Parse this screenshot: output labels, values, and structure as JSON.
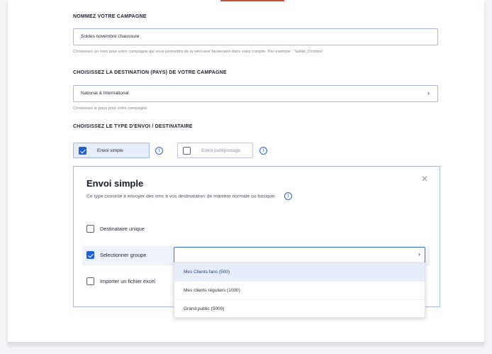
{
  "campaign_name": {
    "title": "NOMMEZ VOTRE CAMPAGNE",
    "value": "Soldes novembre chaussure",
    "hint": "Choisissez un nom pour votre campagne qui vous permettra de la retrouver facilement dans votre compte. Par exemple : 'Solde_Octobre'"
  },
  "destination": {
    "title": "CHOISISSEZ LA DESTINATION (PAYS) DE VOTRE CAMPAGNE",
    "value": "National & International",
    "hint": "Choisissez le pays pour votre campagne"
  },
  "send_type": {
    "title": "CHOISISSEZ LE TYPE D'ENVOI / DESTINATAIRE",
    "options": [
      {
        "label": "Envoi simple",
        "checked": true
      },
      {
        "label": "Envoi publipostage",
        "checked": false
      }
    ]
  },
  "panel": {
    "title": "Envoi simple",
    "description": "Ce type consiste à envoyer des sms à vos destinataires de manière normale ou basique.",
    "recipients": [
      {
        "label": "Destinataire unique",
        "checked": false
      },
      {
        "label": "Selectionner groupe",
        "checked": true
      },
      {
        "label": "Importer un fichier excel",
        "checked": false
      }
    ]
  },
  "group_select": {
    "value": "",
    "options": [
      "Mes Clients fans (500)",
      "Mes clients réguliers (1000)",
      "Grand public (5000)"
    ],
    "highlighted": "Mes Clients fans (500)"
  },
  "icons": {
    "chevron": "chevron-right-icon",
    "info": "info-icon",
    "close": "close-icon",
    "check": "checkbox-icon"
  },
  "colors": {
    "accent": "#1f5fd0",
    "border": "#a9b8d6"
  }
}
